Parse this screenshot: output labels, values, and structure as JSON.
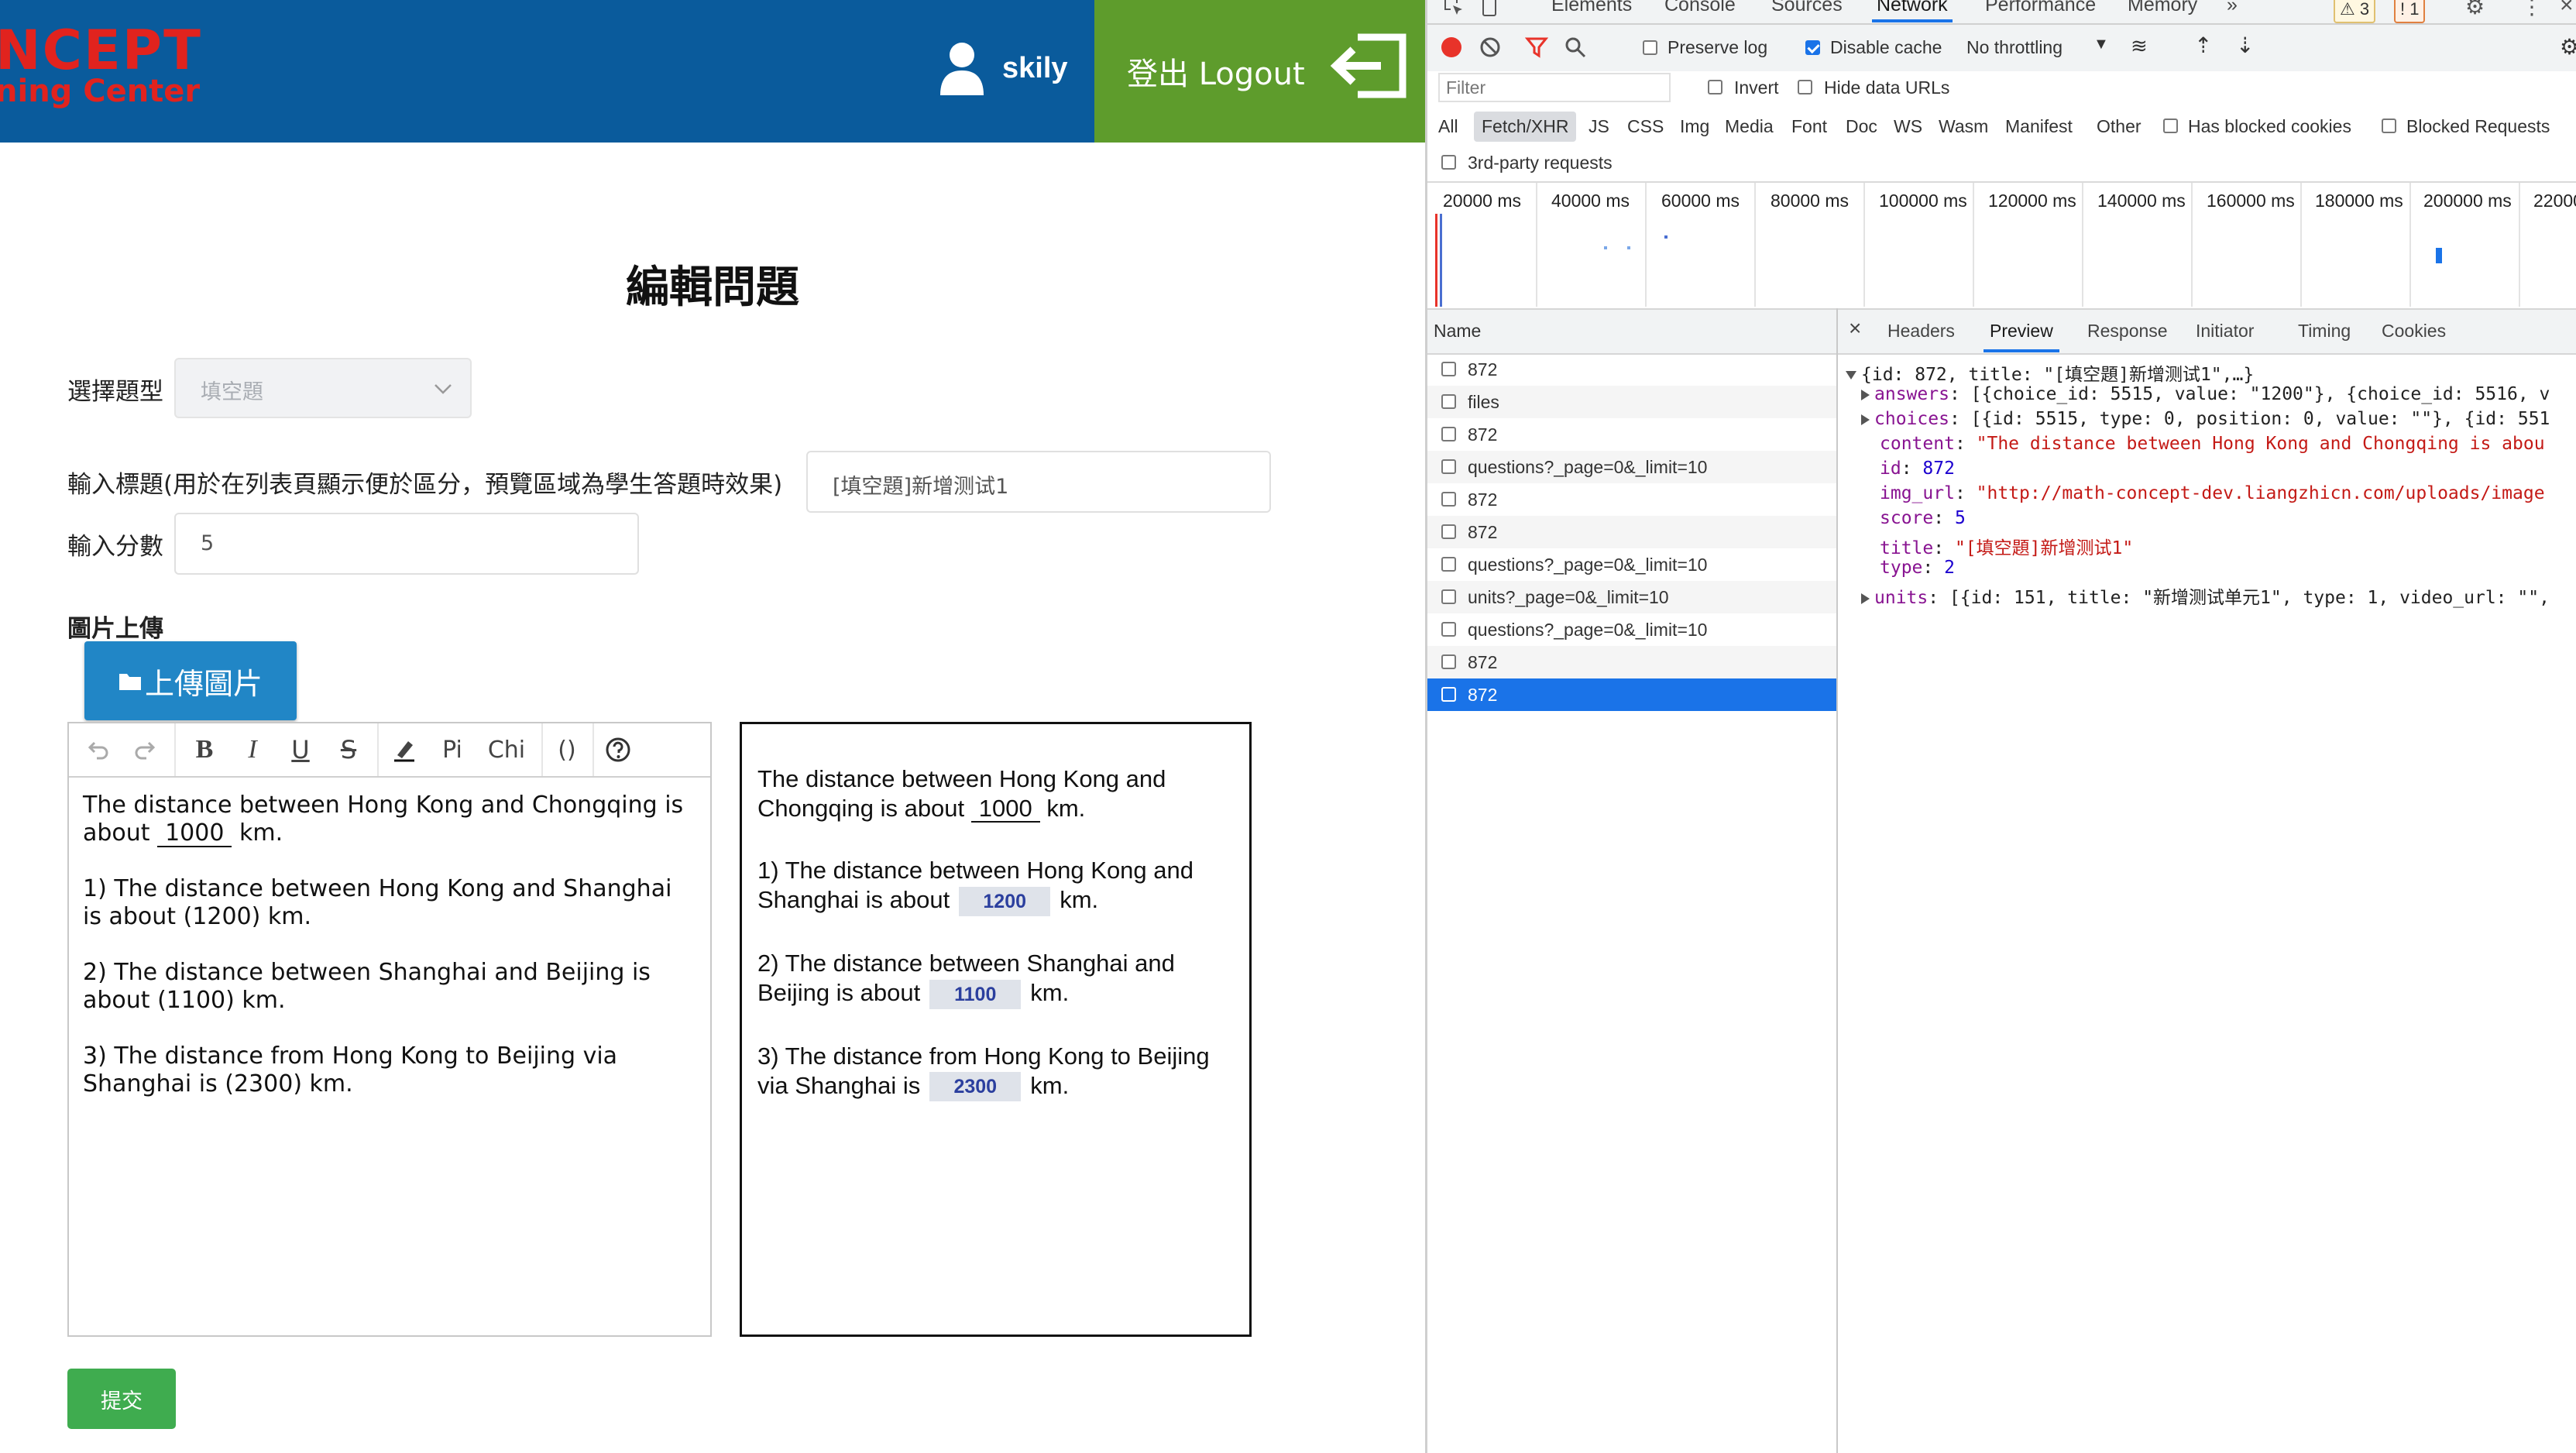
{
  "header": {
    "logo_main": "NCEPT",
    "logo_sub": "ning Center",
    "username": "skily",
    "logout_label": "登出 Logout"
  },
  "form": {
    "page_title": "編輯問題",
    "type_label": "選擇題型",
    "type_value": "填空題",
    "title_label": "輸入標題(用於在列表頁顯示便於區分，預覽區域為學生答題時效果)",
    "title_value": "[填空題]新增测试1",
    "score_label": "輸入分數",
    "score_value": "5",
    "image_label": "圖片上傳",
    "upload_button": "上傳圖片",
    "submit_button": "提交"
  },
  "editor": {
    "toolbar": {
      "pi": "Pi",
      "chi": "Chi",
      "paren": "()"
    },
    "lines": [
      {
        "pre": "The distance between Hong Kong and Chongqing is about ",
        "blank": "1000",
        "post": " km."
      },
      {
        "text": "1) The distance between Hong Kong and Shanghai is about (1200) km."
      },
      {
        "text": "2) The distance between Shanghai and Beijing is about (1100) km."
      },
      {
        "text": "3) The distance from Hong Kong to Beijing via Shanghai is (2300) km."
      }
    ]
  },
  "preview": {
    "intro_pre": "The distance between Hong Kong and Chongqing is about ",
    "intro_blank": "1000",
    "intro_post": " km.",
    "items": [
      {
        "text": "1) The distance between Hong Kong and Shanghai is about",
        "answer": "1200",
        "unit": "km."
      },
      {
        "text": "2) The distance between Shanghai and Beijing is about",
        "answer": "1100",
        "unit": "km."
      },
      {
        "text": "3) The distance from Hong Kong to Beijing via Shanghai is",
        "answer": "2300",
        "unit": "km."
      }
    ]
  },
  "devtools": {
    "tabs": [
      "Elements",
      "Console",
      "Sources",
      "Network",
      "Performance",
      "Memory"
    ],
    "active_tab": "Network",
    "more": "»",
    "warnings": "3",
    "errors": "1",
    "toolbar": {
      "preserve_log": "Preserve log",
      "disable_cache": "Disable cache",
      "throttling": "No throttling"
    },
    "filter_placeholder": "Filter",
    "invert": "Invert",
    "hide_data_urls": "Hide data URLs",
    "type_filters": [
      "All",
      "Fetch/XHR",
      "JS",
      "CSS",
      "Img",
      "Media",
      "Font",
      "Doc",
      "WS",
      "Wasm",
      "Manifest",
      "Other"
    ],
    "active_type": "Fetch/XHR",
    "blocked_cookies": "Has blocked cookies",
    "blocked_requests": "Blocked Requests",
    "third_party": "3rd-party requests",
    "timeline_ticks": [
      "20000 ms",
      "40000 ms",
      "60000 ms",
      "80000 ms",
      "100000 ms",
      "120000 ms",
      "140000 ms",
      "160000 ms",
      "180000 ms",
      "200000 ms",
      "22000"
    ],
    "name_header": "Name",
    "requests": [
      "872",
      "files",
      "872",
      "questions?_page=0&_limit=10",
      "872",
      "872",
      "questions?_page=0&_limit=10",
      "units?_page=0&_limit=10",
      "questions?_page=0&_limit=10",
      "872",
      "872"
    ],
    "selected_request": 10,
    "detail_tabs": [
      "Headers",
      "Preview",
      "Response",
      "Initiator",
      "Timing",
      "Cookies"
    ],
    "active_detail_tab": "Preview",
    "preview_json": {
      "summary": "{id: 872, title: \"[填空題]新增测试1\",…}",
      "answers": "[{choice_id: 5515, value: \"1200\"}, {choice_id: 5516, v",
      "choices": "[{id: 5515, type: 0, position: 0, value: \"\"}, {id: 551",
      "content": "\"The distance between Hong Kong and Chongqing is abou",
      "id": "872",
      "img_url": "\"http://math-concept-dev.liangzhicn.com/uploads/image",
      "score": "5",
      "title": "\"[填空題]新增测试1\"",
      "type": "2",
      "units": "[{id: 151, title: \"新增测试单元1\", type: 1, video_url: \"\","
    }
  }
}
